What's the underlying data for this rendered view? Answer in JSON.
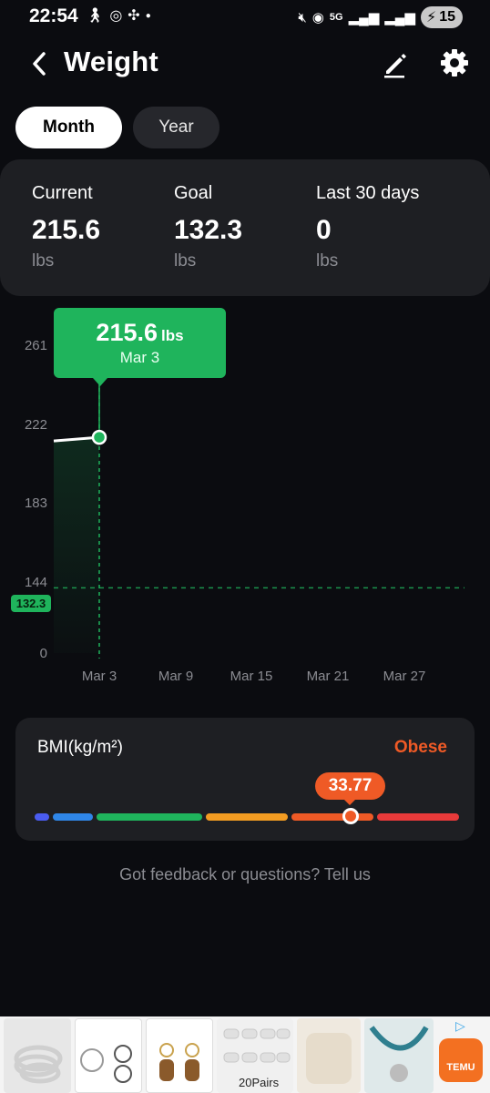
{
  "status_bar": {
    "time": "22:54",
    "battery": "15",
    "network": "5G"
  },
  "header": {
    "title": "Weight"
  },
  "tabs": [
    {
      "label": "Month",
      "selected": true
    },
    {
      "label": "Year",
      "selected": false
    }
  ],
  "stats": {
    "current": {
      "label": "Current",
      "value": "215.6",
      "unit": "lbs"
    },
    "goal": {
      "label": "Goal",
      "value": "132.3",
      "unit": "lbs"
    },
    "last30": {
      "label": "Last 30 days",
      "value": "0",
      "unit": "lbs"
    }
  },
  "tooltip": {
    "value": "215.6",
    "unit": "lbs",
    "date": "Mar 3"
  },
  "chart_data": {
    "type": "line",
    "y_ticks": [
      "261",
      "222",
      "183",
      "144",
      "0"
    ],
    "x_ticks": [
      "Mar 3",
      "Mar 9",
      "Mar 15",
      "Mar 21",
      "Mar 27"
    ],
    "series": [
      {
        "x": [
          "Mar 3"
        ],
        "values": [
          215.6
        ]
      }
    ],
    "goal_line": {
      "value": 132.3,
      "label": "132.3"
    },
    "ylim": [
      0,
      261
    ],
    "colors": {
      "line": "#ffffff",
      "accent": "#1fb45c",
      "goal": "#1fb45c"
    }
  },
  "bmi": {
    "title": "BMI(kg/m²)",
    "status": "Obese",
    "value": "33.77",
    "indicator_fraction": 0.752,
    "colors": {
      "status": "#ef5a26"
    },
    "segments": [
      {
        "color": "#4a5cf0"
      },
      {
        "color": "#2f86e8"
      },
      {
        "color": "#1fb45c"
      },
      {
        "color": "#f39c22"
      },
      {
        "color": "#ef5a26"
      },
      {
        "color": "#e83a3a"
      }
    ]
  },
  "feedback": {
    "text": "Got feedback or questions? Tell us"
  },
  "ad": {
    "pairs_label": "20Pairs",
    "brand": "TEMU"
  }
}
